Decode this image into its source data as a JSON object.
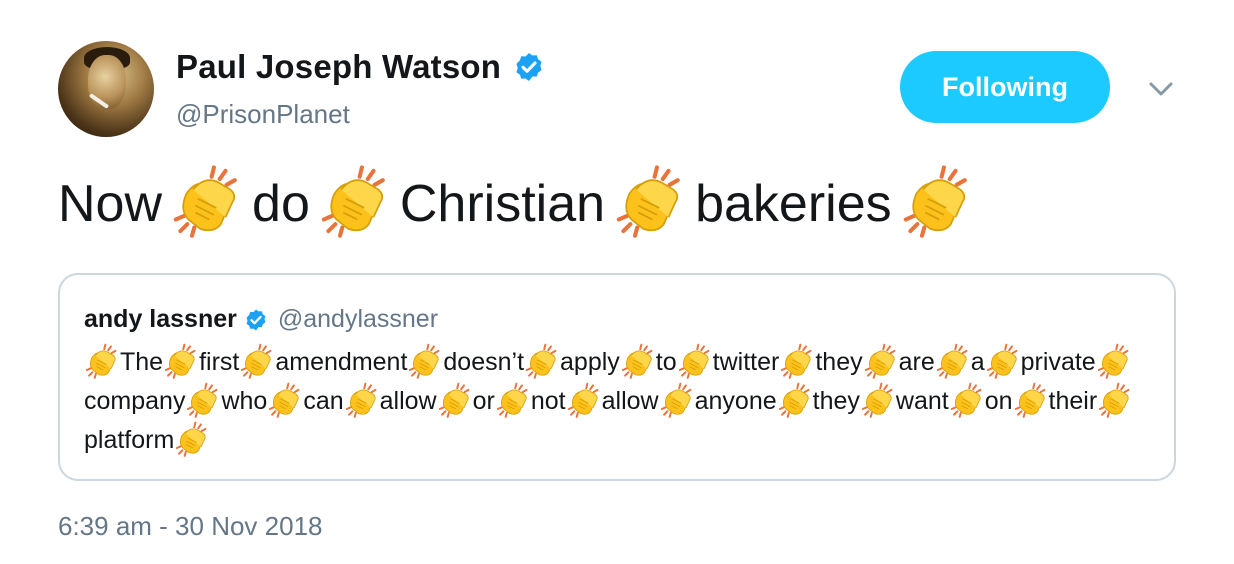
{
  "author": {
    "name": "Paul Joseph Watson",
    "handle": "@PrisonPlanet",
    "verified": true
  },
  "follow_button": {
    "label": "Following",
    "color": "#1dcaff"
  },
  "menu": {
    "icon": "chevron-down-icon"
  },
  "tweet": {
    "words": [
      "Now",
      "do",
      "Christian",
      "bakeries"
    ],
    "separator_icon": "clapping-hands-icon"
  },
  "quoted_tweet": {
    "name": "andy lassner",
    "handle": "@andylassner",
    "verified": true,
    "words": [
      "The",
      "first",
      "amendment",
      "doesn’t",
      "apply",
      "to",
      "twitter",
      "they",
      "are",
      "a",
      "private",
      "company",
      "who",
      "can",
      "allow",
      "or",
      "not",
      "allow",
      "anyone",
      "they",
      "want",
      "on",
      "their",
      "platform"
    ],
    "separator_icon": "clapping-hands-icon"
  },
  "timestamp": "6:39 am - 30 Nov 2018",
  "colors": {
    "text": "#14171a",
    "secondary": "#657786",
    "verified_blue": "#1da1f2",
    "border": "#ccd6dd"
  }
}
